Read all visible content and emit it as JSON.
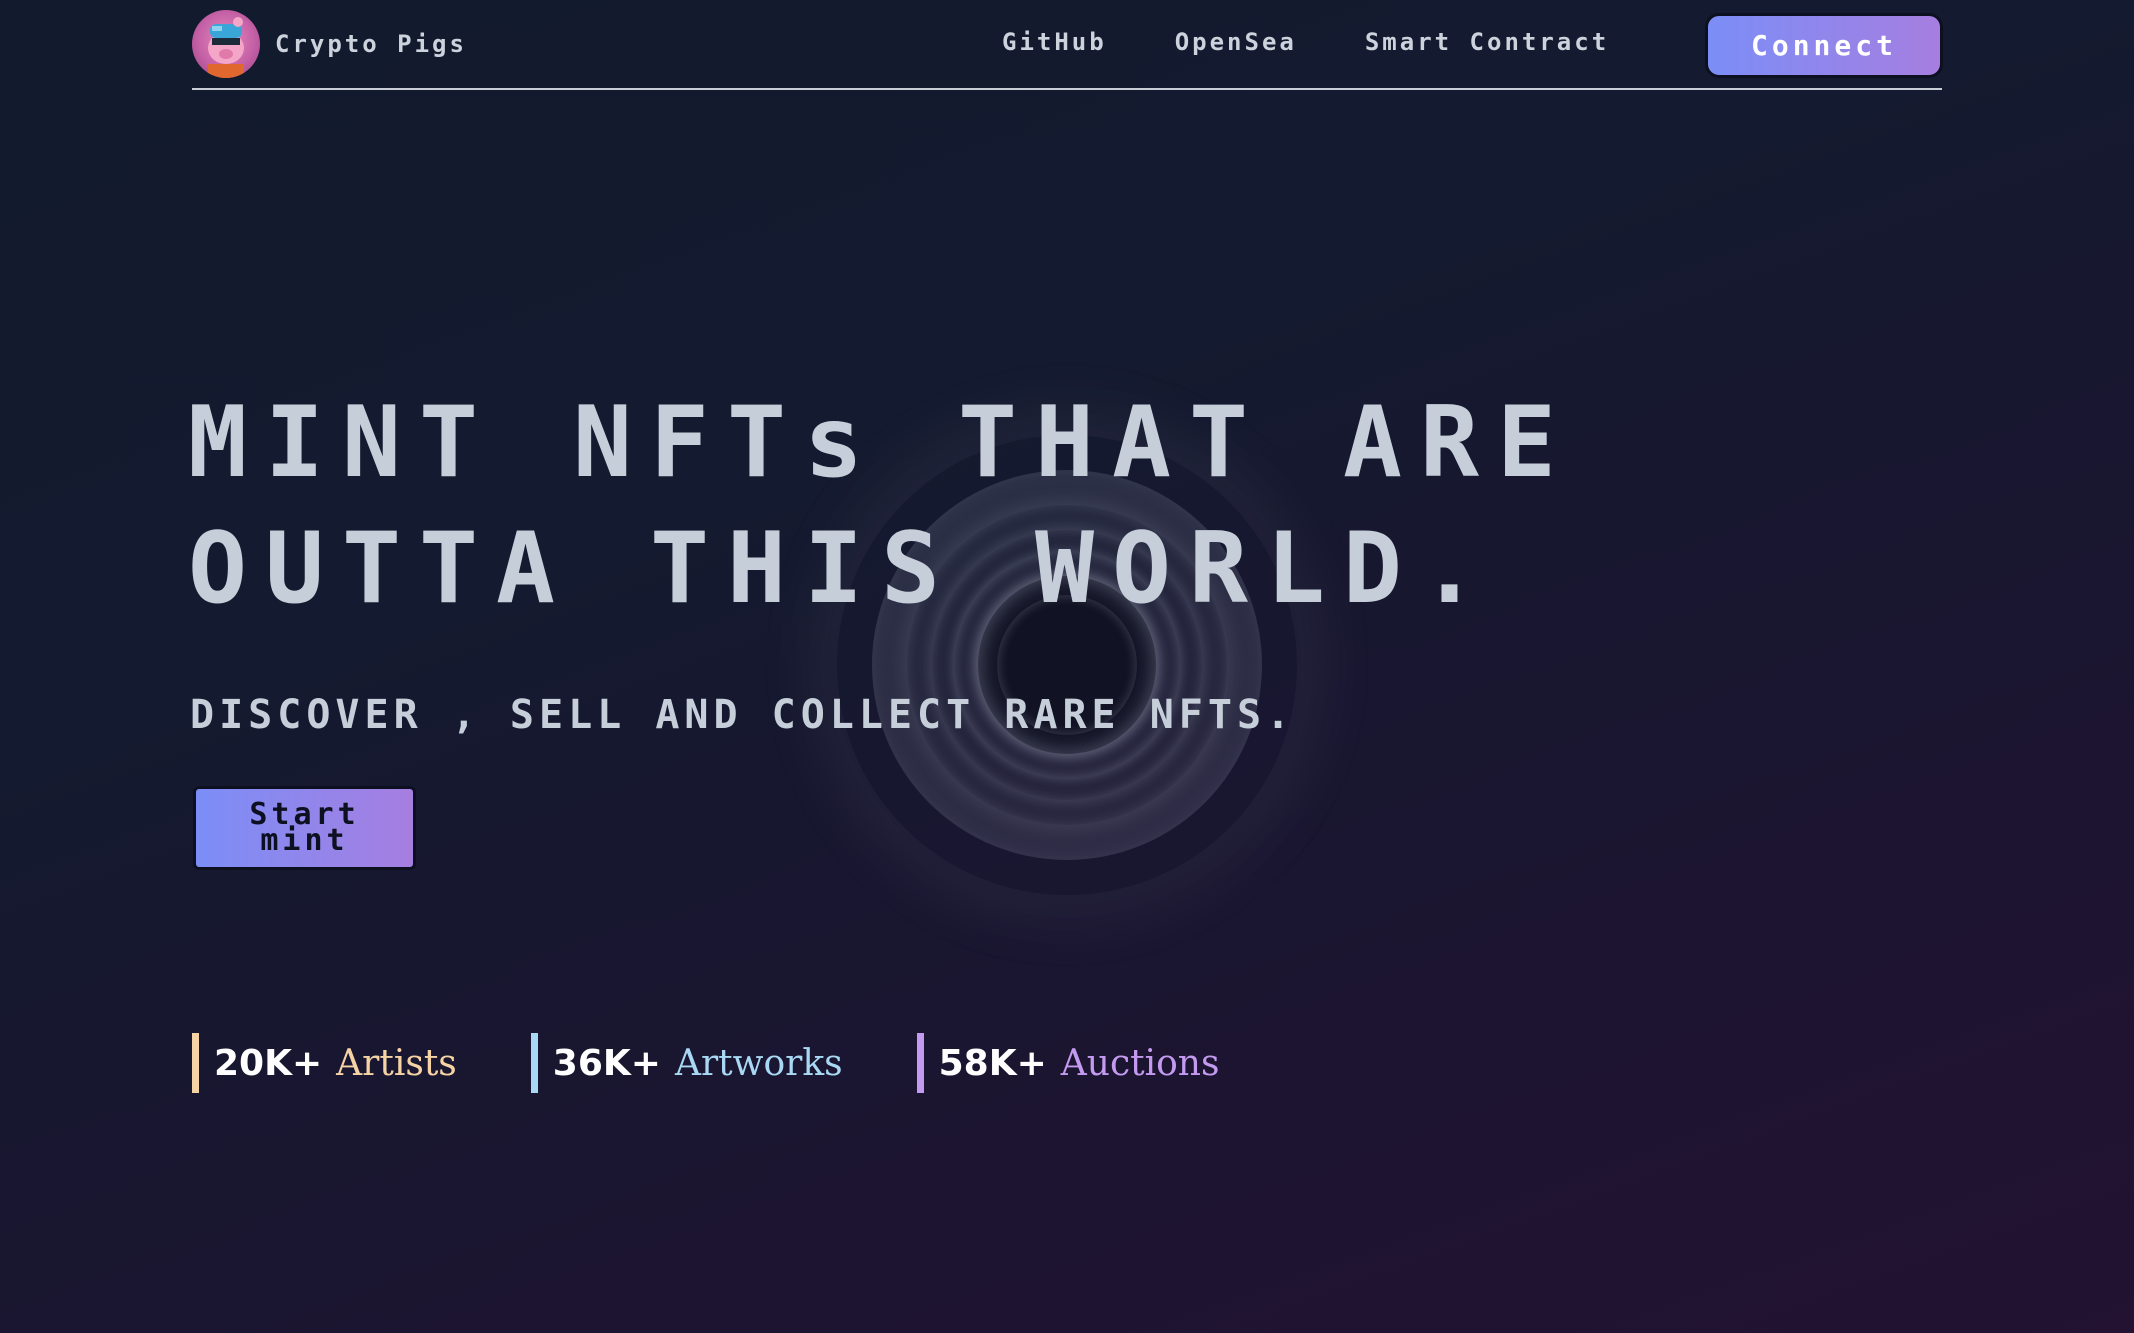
{
  "header": {
    "brand": "Crypto Pigs",
    "nav": [
      "GitHub",
      "OpenSea",
      "Smart Contract"
    ],
    "connect_label": "Connect",
    "avatar_icon": "pig-avatar-icon"
  },
  "hero": {
    "title_line1": "MINT NFTs THAT ARE",
    "title_line2": "OUTTA THIS WORLD.",
    "subtitle": "DISCOVER , SELL AND COLLECT RARE NFTS.",
    "start_label": "Start mint"
  },
  "stats": [
    {
      "value": "20K+",
      "label": "Artists",
      "color": "#f6d3a5"
    },
    {
      "value": "36K+",
      "label": "Artworks",
      "color": "#a9d8f4"
    },
    {
      "value": "58K+",
      "label": "Auctions",
      "color": "#c39af0"
    }
  ],
  "colors": {
    "accent_start": "#7b8ef7",
    "accent_end": "#a67ee0",
    "text": "#c5ced9"
  }
}
